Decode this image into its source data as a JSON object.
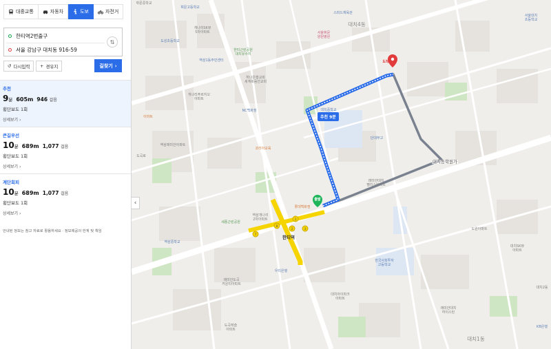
{
  "modes": [
    {
      "label": "대중교통",
      "icon": "bus-icon",
      "active": false
    },
    {
      "label": "자동차",
      "icon": "car-icon",
      "active": false
    },
    {
      "label": "도보",
      "icon": "walk-icon",
      "active": true
    },
    {
      "label": "자전거",
      "icon": "bicycle-icon",
      "active": false
    }
  ],
  "route": {
    "origin": "한티역2번출구",
    "destination": "서울 강남구 대치동 916-59",
    "swap_icon": "⇅"
  },
  "actions": {
    "reset_label": "다시입력",
    "waypoint_label": "경유지",
    "search_label": "길찾기"
  },
  "results": [
    {
      "type": "추천",
      "minutes": "9",
      "minute_unit": "분",
      "distance": "605m",
      "steps": "946",
      "step_unit": "걸음",
      "crossings": "횡단보도 1회",
      "detail": "상세보기"
    },
    {
      "type": "큰길우선",
      "minutes": "10",
      "minute_unit": "분",
      "distance": "689m",
      "steps": "1,077",
      "step_unit": "걸음",
      "crossings": "횡단보도 1회",
      "detail": "상세보기"
    },
    {
      "type": "계단회피",
      "minutes": "10",
      "minute_unit": "분",
      "distance": "689m",
      "steps": "1,077",
      "step_unit": "걸음",
      "crossings": "횡단보도 1회",
      "detail": "상세보기"
    }
  ],
  "notice": "안내된 정보는 참고 자료로 활용하세요 · 정보제공의 한계 및 책임",
  "map": {
    "route_badge": "추천 9분",
    "start_label": "출발",
    "end_label": "도착",
    "colors": {
      "selected_route": "#2b6de9",
      "alt_route": "#7a8290",
      "start": "#1fb55b",
      "end": "#e23b3b",
      "subway": "#f5d400"
    },
    "dong_labels": [
      "대치4동",
      "대치1동"
    ],
    "road_labels": [
      "대치동학원가"
    ],
    "station": "한티역",
    "places": [
      {
        "text": "휘문중학교",
        "color": "gray"
      },
      {
        "text": "개나리SK뷰\n5차아파트",
        "color": "gray"
      },
      {
        "text": "스피드체육관",
        "color": "blue"
      },
      {
        "text": "휘문고등학교",
        "color": "blue"
      },
      {
        "text": "서울대치\n초등학교",
        "color": "blue"
      },
      {
        "text": "도성초등학교",
        "color": "blue"
      },
      {
        "text": "한티근린공원\n대치유수지",
        "color": "green"
      },
      {
        "text": "서울휘문\n양원병원",
        "color": "pink"
      },
      {
        "text": "역삼1동주민센터",
        "color": "blue"
      },
      {
        "text": "하나은행교회\n세계복음선교회",
        "color": "gray"
      },
      {
        "text": "개나리푸르지오\n아파트",
        "color": "gray"
      },
      {
        "text": "이마트",
        "color": "orange"
      },
      {
        "text": "역삼래미안아파트",
        "color": "gray"
      },
      {
        "text": "NC백화점",
        "color": "blue"
      },
      {
        "text": "대치중학교",
        "color": "blue"
      },
      {
        "text": "코리아교육",
        "color": "orange"
      },
      {
        "text": "도곡로",
        "color": "gray"
      },
      {
        "text": "단대부고",
        "color": "blue"
      },
      {
        "text": "래미안대치\n팰리스아파트",
        "color": "gray"
      },
      {
        "text": "롯데백화점",
        "color": "orange"
      },
      {
        "text": "역삼개나리\n2차아파트",
        "color": "gray"
      },
      {
        "text": "역삼중학교",
        "color": "blue"
      },
      {
        "text": "세풍근린공원",
        "color": "green"
      },
      {
        "text": "우리은행",
        "color": "blue"
      },
      {
        "text": "래미안도곡\n카운티아파트",
        "color": "gray"
      },
      {
        "text": "도곡렉슬\n아파트",
        "color": "gray"
      },
      {
        "text": "한국사회투자\n고등학교",
        "color": "blue"
      },
      {
        "text": "대치아이파크\n아파트",
        "color": "gray"
      },
      {
        "text": "대치SK뷰\n아파트",
        "color": "gray"
      },
      {
        "text": "도원아파트",
        "color": "gray"
      },
      {
        "text": "대치2동",
        "color": "gray"
      },
      {
        "text": "KB은행",
        "color": "blue"
      },
      {
        "text": "래미안대치\n하이스턴",
        "color": "gray"
      }
    ]
  }
}
